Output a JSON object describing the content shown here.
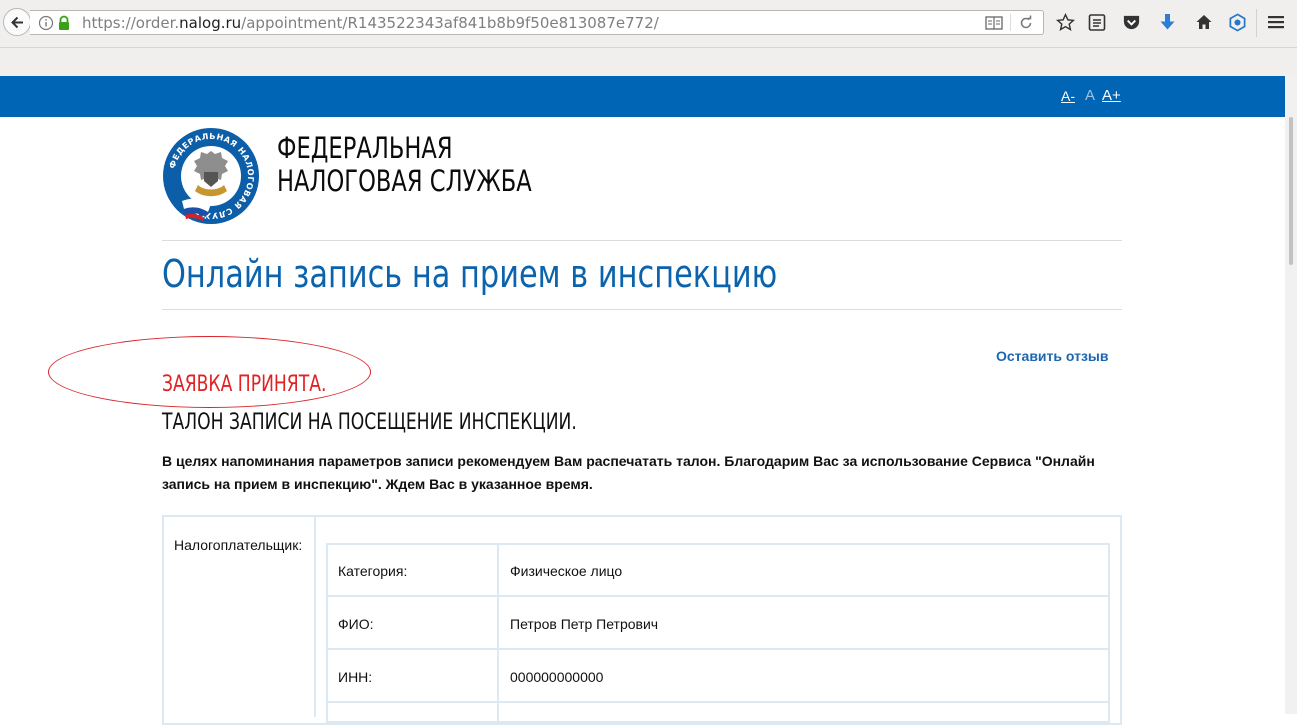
{
  "browser": {
    "url_prefix": "https://order.",
    "url_host": "nalog.ru",
    "url_path": "/appointment/R143522343af841b8b9f50e813087e772/"
  },
  "header": {
    "font_smaller": "A-",
    "font_normal": "A",
    "font_larger": "A+"
  },
  "logo": {
    "org_line1": "ФЕДЕРАЛЬНАЯ",
    "org_line2": "НАЛОГОВАЯ СЛУЖБА",
    "emblem_text": "ФЕДЕРАЛЬНАЯ НАЛОГОВАЯ СЛУЖБА"
  },
  "page": {
    "title": "Онлайн запись на прием в инспекцию",
    "feedback_link": "Оставить отзыв",
    "status": "ЗАЯВКА ПРИНЯТА.",
    "ticket_title": "ТАЛОН ЗАПИСИ НА ПОСЕЩЕНИЕ ИНСПЕКЦИИ.",
    "notice": "В целях напоминания параметров записи рекомендуем Вам распечатать талон. Благодарим Вас за использование Сервиса \"Онлайн запись на прием в инспекцию\". Ждем Вас в указанное время."
  },
  "taxpayer": {
    "label": "Налогоплательщик:",
    "rows": [
      {
        "label": "Категория:",
        "value": "Физическое лицо"
      },
      {
        "label": "ФИО:",
        "value": "Петров Петр Петрович"
      },
      {
        "label": "ИНН:",
        "value": "000000000000"
      }
    ]
  },
  "colors": {
    "header_blue": "#0065b4",
    "title_blue": "#0b63ad",
    "status_red": "#e02224"
  }
}
